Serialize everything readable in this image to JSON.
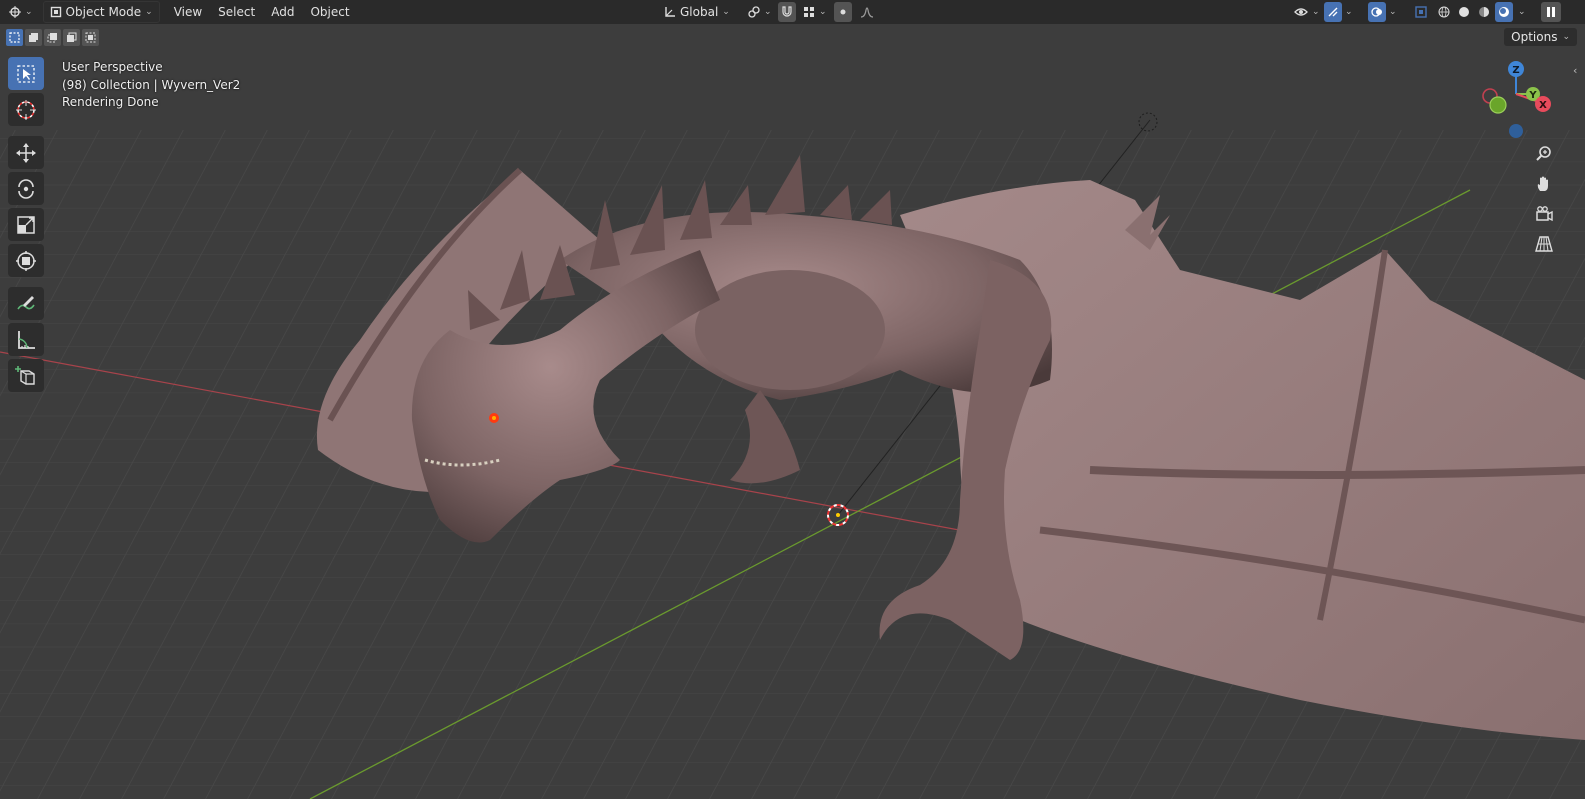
{
  "header": {
    "mode_label": "Object Mode",
    "menus": [
      "View",
      "Select",
      "Add",
      "Object"
    ],
    "orientation_label": "Global"
  },
  "subbar": {
    "options_label": "Options"
  },
  "overlay": {
    "line1": "User Perspective",
    "line2": "(98) Collection | Wyvern_Ver2",
    "line3": "Rendering Done"
  },
  "gizmo": {
    "z_label": "Z",
    "y_label": "Y",
    "x_label": "X"
  },
  "toolbar": {
    "tools": [
      "select-box",
      "cursor",
      "move",
      "rotate",
      "scale",
      "transform",
      "annotate",
      "measure",
      "add-cube"
    ]
  },
  "colors": {
    "accent": "#4772b3",
    "x_axis": "#e84b5c",
    "y_axis": "#8bc34a",
    "z_axis": "#3f86d8",
    "model": "#7d6464"
  }
}
